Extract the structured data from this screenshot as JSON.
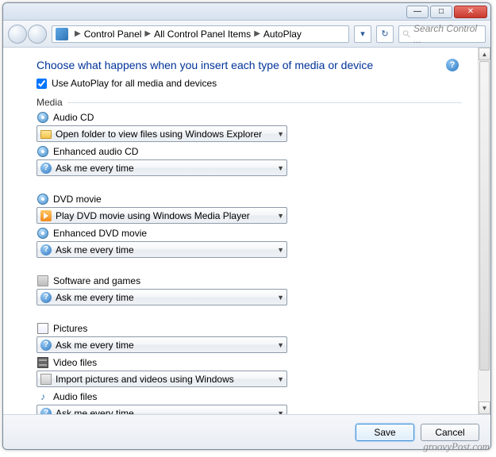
{
  "titlebar": {
    "minimize": "—",
    "maximize": "□",
    "close": "✕"
  },
  "nav": {
    "crumb1": "Control Panel",
    "crumb2": "All Control Panel Items",
    "crumb3": "AutoPlay",
    "search_placeholder": "Search Control ..."
  },
  "page": {
    "heading": "Choose what happens when you insert each type of media or device",
    "use_autoplay_label": "Use AutoPlay for all media and devices",
    "group_media": "Media"
  },
  "items": {
    "audio_cd": {
      "label": "Audio CD",
      "value": "Open folder to view files using Windows Explorer"
    },
    "enh_audio_cd": {
      "label": "Enhanced audio CD",
      "value": "Ask me every time"
    },
    "dvd_movie": {
      "label": "DVD movie",
      "value": "Play DVD movie using Windows Media Player"
    },
    "enh_dvd_movie": {
      "label": "Enhanced DVD movie",
      "value": "Ask me every time"
    },
    "software": {
      "label": "Software and games",
      "value": "Ask me every time"
    },
    "pictures": {
      "label": "Pictures",
      "value": "Ask me every time"
    },
    "video": {
      "label": "Video files",
      "value": "Import pictures and videos using Windows"
    },
    "audio_files": {
      "label": "Audio files",
      "value": "Ask me every time"
    }
  },
  "footer": {
    "save": "Save",
    "cancel": "Cancel"
  },
  "watermark": "groovyPost.com"
}
